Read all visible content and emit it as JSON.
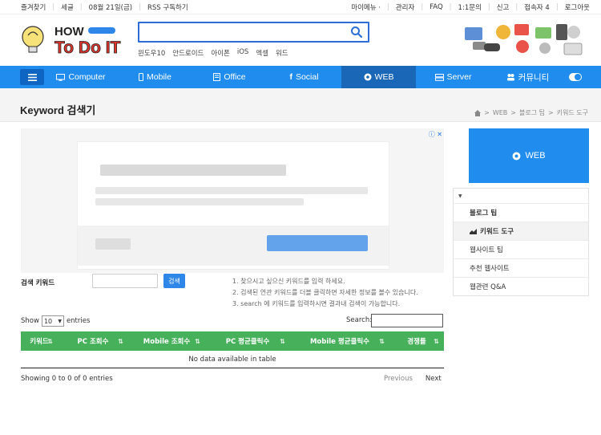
{
  "topbar": {
    "left": [
      "즐겨찾기",
      "세글",
      "08월 21일(금)",
      "RSS 구독하기"
    ],
    "right": [
      "마이메뉴 ·",
      "관리자",
      "FAQ",
      "1:1문의",
      "신고",
      "접속자 4",
      "로그아웃"
    ]
  },
  "logo": {
    "line1": "HOW",
    "line2": "To Do IT"
  },
  "search": {
    "value": "",
    "placeholder": ""
  },
  "quick_links": [
    "윈도우10",
    "안드로이드",
    "아이폰",
    "iOS",
    "엑셀",
    "워드"
  ],
  "nav": {
    "items": [
      {
        "label": "Computer",
        "icon": "monitor-icon"
      },
      {
        "label": "Mobile",
        "icon": "phone-icon"
      },
      {
        "label": "Office",
        "icon": "document-icon"
      },
      {
        "label": "Social",
        "icon": "facebook-icon"
      },
      {
        "label": "WEB",
        "icon": "chrome-icon",
        "active": true
      },
      {
        "label": "Server",
        "icon": "server-icon"
      },
      {
        "label": "커뮤니티",
        "icon": "people-icon"
      }
    ]
  },
  "page": {
    "title": "Keyword 검색기",
    "breadcrumb": [
      "WEB",
      "블로그 팁",
      "키워드 도구"
    ]
  },
  "form": {
    "label": "검색 키워드",
    "input_value": "",
    "button": "검색",
    "hints": [
      "1. 찾으시고 싶으신 키워드를 입력 하세요.",
      "2. 검색된 연관 키워드를 더블 클릭하면 자세한 정보를 볼수 있습니다.",
      "3. search 에 키워드를 입력하시면 결과내 검색이 가능합니다."
    ]
  },
  "table": {
    "show_label": "Show",
    "show_value": "10",
    "entries_label": "entries",
    "search_label": "Search:",
    "columns": [
      "키워드",
      "PC 조회수",
      "Mobile 조회수",
      "PC 평균클릭수",
      "Mobile 평균클릭수",
      "경쟁률"
    ],
    "empty": "No data available in table",
    "info": "Showing 0 to 0 of 0 entries",
    "prev": "Previous",
    "next": "Next"
  },
  "sidebar": {
    "banner": "WEB",
    "items": [
      {
        "label": "블로그 팁",
        "type": "bold"
      },
      {
        "label": "키워드 도구",
        "type": "active"
      },
      {
        "label": "웹사이트 팁",
        "type": "normal"
      },
      {
        "label": "추천 웹사이트",
        "type": "normal"
      },
      {
        "label": "웹관련 Q&A",
        "type": "normal"
      }
    ]
  },
  "colors": {
    "nav": "#1f8cee",
    "nav_active": "#1a67b8",
    "table_header": "#46b05a",
    "search_border": "#2c6ed5"
  }
}
